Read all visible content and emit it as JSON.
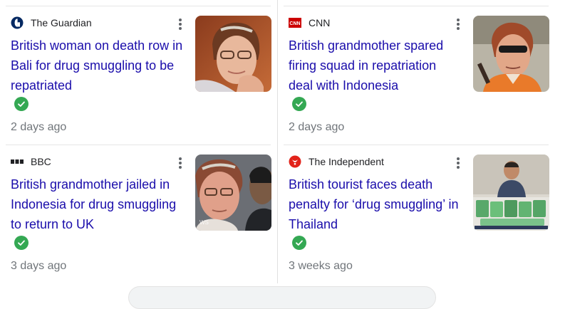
{
  "cards": [
    {
      "source": "The Guardian",
      "source_icon": "guardian-logo-icon",
      "headline": "British woman on death row in Bali for drug smuggling to be repatriated",
      "time": "2 days ago",
      "verified": true
    },
    {
      "source": "CNN",
      "source_icon": "cnn-logo-icon",
      "source_logo_text": "CNN",
      "headline": "British grandmother spared firing squad in repatriation deal with Indonesia",
      "time": "2 days ago",
      "verified": true
    },
    {
      "source": "BBC",
      "source_icon": "bbc-logo-icon",
      "headline": "British grandmother jailed in Indonesia for drug smuggling to return to UK",
      "time": "3 days ago",
      "verified": true
    },
    {
      "source": "The Independent",
      "source_icon": "independent-logo-icon",
      "headline": "British tourist faces death penalty for ‘drug smuggling’ in Thailand",
      "time": "3 weeks ago",
      "verified": true
    }
  ],
  "colors": {
    "link": "#1a0dab",
    "verified": "#34a853",
    "meta": "#70757a"
  }
}
